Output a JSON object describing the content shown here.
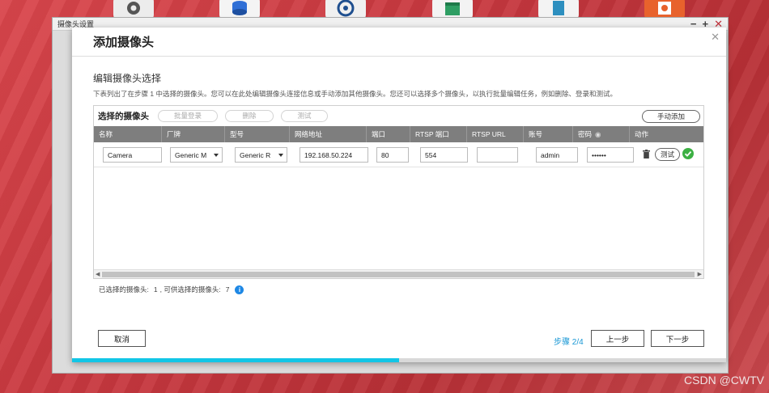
{
  "outer_window": {
    "title": "摄像头设置"
  },
  "dialog": {
    "title": "添加摄像头",
    "section_title": "编辑摄像头选择",
    "description": "下表列出了在步骤 1 中选择的摄像头。您可以在此处编辑摄像头连接信息或手动添加其他摄像头。您还可以选择多个摄像头，以执行批量编辑任务，例如删除、登录和测试。"
  },
  "panel": {
    "label": "选择的摄像头",
    "batch_login": "批量登录",
    "delete": "删除",
    "test": "测试",
    "manual_add": "手动添加"
  },
  "columns": [
    "名称",
    "厂牌",
    "型号",
    "网络地址",
    "端口",
    "RTSP 端口",
    "RTSP URL",
    "账号",
    "密码",
    "动作"
  ],
  "row": {
    "name": "Camera",
    "brand": "Generic M",
    "model": "Generic R",
    "address": "192.168.50.224",
    "port": "80",
    "rtsp_port": "554",
    "rtsp_url": "",
    "account": "admin",
    "password": "••••••",
    "test_label": "测试"
  },
  "status": {
    "selected_label": "已选择的摄像头:",
    "selected_count": "1",
    "available_label": ", 可供选择的摄像头:",
    "available_count": "7"
  },
  "footer": {
    "cancel": "取消",
    "step": "步骤 2/4",
    "prev": "上一步",
    "next": "下一步",
    "progress": 0.5
  },
  "watermark": "CSDN @CWTV",
  "colors": {
    "accent": "#12c6e6",
    "step_text": "#1a98d5",
    "ok_green": "#3cb043",
    "header_gray": "#7e7e7e"
  }
}
